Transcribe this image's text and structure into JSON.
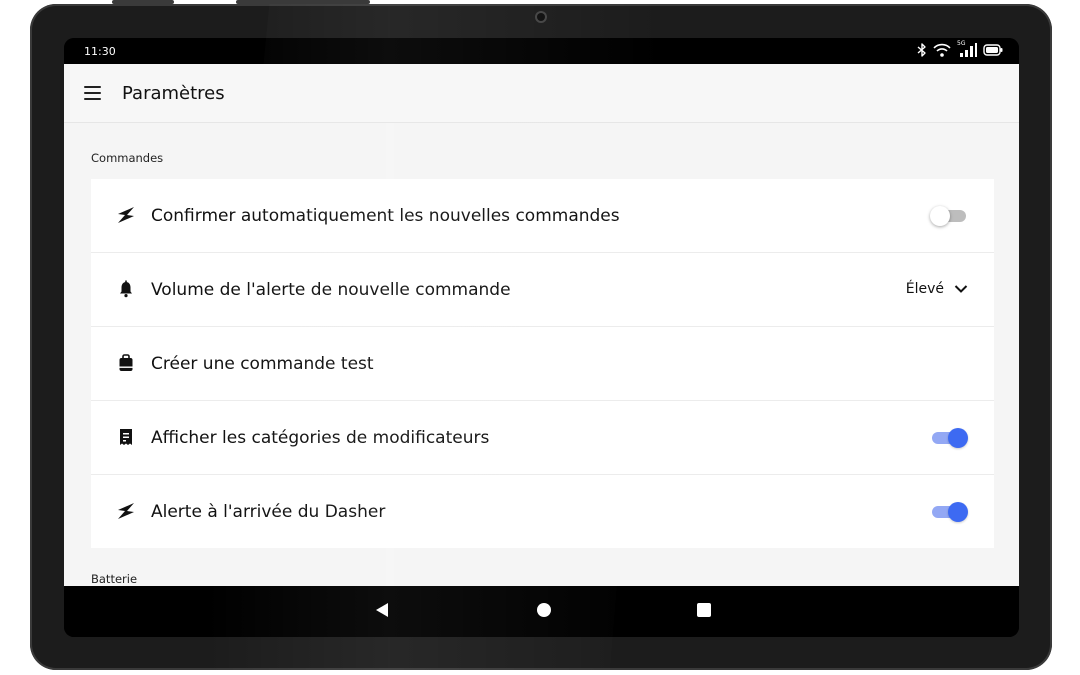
{
  "status_bar": {
    "time": "11:30",
    "icons": [
      "bluetooth-icon",
      "wifi-icon",
      "5g-signal-icon",
      "battery-icon"
    ],
    "network_label": "5G"
  },
  "app_bar": {
    "title": "Paramètres",
    "menu_icon": "hamburger-menu-icon"
  },
  "sections": [
    {
      "label": "Commandes",
      "rows": [
        {
          "label": "Confirmer automatiquement les nouvelles commandes",
          "icon": "lightning-icon",
          "control": "toggle",
          "on": false
        },
        {
          "label": "Volume de l'alerte de nouvelle commande",
          "icon": "bell-icon",
          "control": "select",
          "value": "Élevé"
        },
        {
          "label": "Créer une commande test",
          "icon": "bag-icon",
          "control": "none"
        },
        {
          "label": "Afficher les catégories de modificateurs",
          "icon": "receipt-icon",
          "control": "toggle",
          "on": true
        },
        {
          "label": "Alerte à l'arrivée du Dasher",
          "icon": "lightning-icon",
          "control": "toggle",
          "on": true
        }
      ]
    },
    {
      "label": "Batterie"
    }
  ],
  "nav_bar": {
    "buttons": [
      "back-icon",
      "home-icon",
      "recents-icon"
    ]
  },
  "colors": {
    "toggle_on_thumb": "#3d6af2",
    "toggle_on_track": "#93a8f4",
    "toggle_off_track": "#bdbdbd",
    "app_background": "#f5f5f5",
    "device_frame": "#1c1c1c"
  }
}
